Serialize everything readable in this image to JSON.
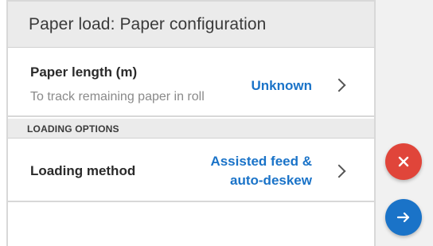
{
  "header": {
    "title": "Paper load: Paper configuration"
  },
  "paper_length": {
    "label": "Paper length (m)",
    "description": "To track remaining paper in roll",
    "value": "Unknown"
  },
  "loading_options": {
    "section_title": "LOADING OPTIONS",
    "loading_method": {
      "label": "Loading method",
      "value_line1": "Assisted feed &",
      "value_line2": "auto-deskew"
    }
  },
  "actions": {
    "cancel_icon": "close-icon",
    "next_icon": "arrow-right-icon",
    "cancel_color": "#e0453a",
    "next_color": "#1a73c8"
  },
  "colors": {
    "accent": "#1a73c8",
    "header_bg": "#ebebeb"
  }
}
